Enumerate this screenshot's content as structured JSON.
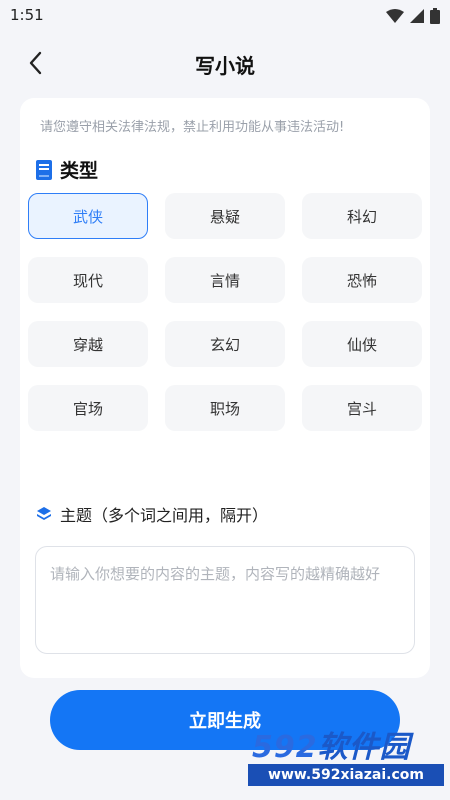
{
  "status_bar": {
    "time": "1:51"
  },
  "header": {
    "title": "写小说"
  },
  "notice": "请您遵守相关法律法规，禁止利用功能从事违法活动!",
  "type_section": {
    "label": "类型",
    "options": [
      "武侠",
      "悬疑",
      "科幻",
      "现代",
      "言情",
      "恐怖",
      "穿越",
      "玄幻",
      "仙侠",
      "官场",
      "职场",
      "宫斗"
    ],
    "selected": "武侠"
  },
  "topic_section": {
    "label": "主题（多个词之间用，隔开）",
    "placeholder": "请输入你想要的内容的主题，内容写的越精确越好"
  },
  "generate_button": {
    "label": "立即生成"
  },
  "watermark": {
    "brand_num": "592",
    "brand_text": "软件园",
    "url": "www.592xiazai.com"
  },
  "colors": {
    "accent": "#1476f5",
    "selected_border": "#2f7ef7",
    "selected_bg": "#eaf3ff",
    "page_bg": "#f4f5f9"
  }
}
